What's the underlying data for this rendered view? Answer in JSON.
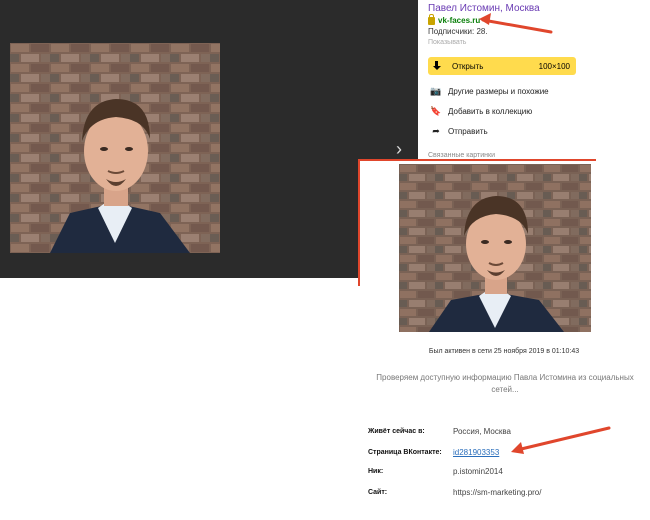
{
  "viewer": {
    "next_arrow": "›"
  },
  "panel": {
    "author": "Павел Истомин, Москва",
    "site": "vk-faces.ru",
    "subscribers": "Подписчики: 28.",
    "subscribers_extra": "Показывать",
    "open_button": {
      "label": "Открыть",
      "size": "100×100"
    },
    "menu": [
      {
        "icon": "camera-icon",
        "glyph": "📷",
        "label": "Другие размеры и похожие"
      },
      {
        "icon": "bookmark-icon",
        "glyph": "🔖",
        "label": "Добавить в коллекцию"
      },
      {
        "icon": "share-icon",
        "glyph": "➦",
        "label": "Отправить"
      }
    ],
    "related": "Связанные картинки"
  },
  "profile": {
    "last_active": "Был активен в сети 25 ноября 2019 в 01:10:43",
    "checking": "Проверяем доступную информацию Павла Истомина из социальных сетей...",
    "rows": [
      {
        "label": "Живёт сейчас в:",
        "value": "Россия, Москва"
      },
      {
        "label": "Страница ВКонтакте:",
        "value": "id281903353"
      },
      {
        "label": "Ник:",
        "value": "p.istomin2014"
      },
      {
        "label": "Сайт:",
        "value": "https://sm-marketing.pro/"
      }
    ]
  },
  "colors": {
    "accent_red": "#e0462c",
    "open_button": "#ffdb4d",
    "viewer_bg": "#2b2b2b",
    "author": "#6a3bb3",
    "site": "#0a7f0a"
  }
}
